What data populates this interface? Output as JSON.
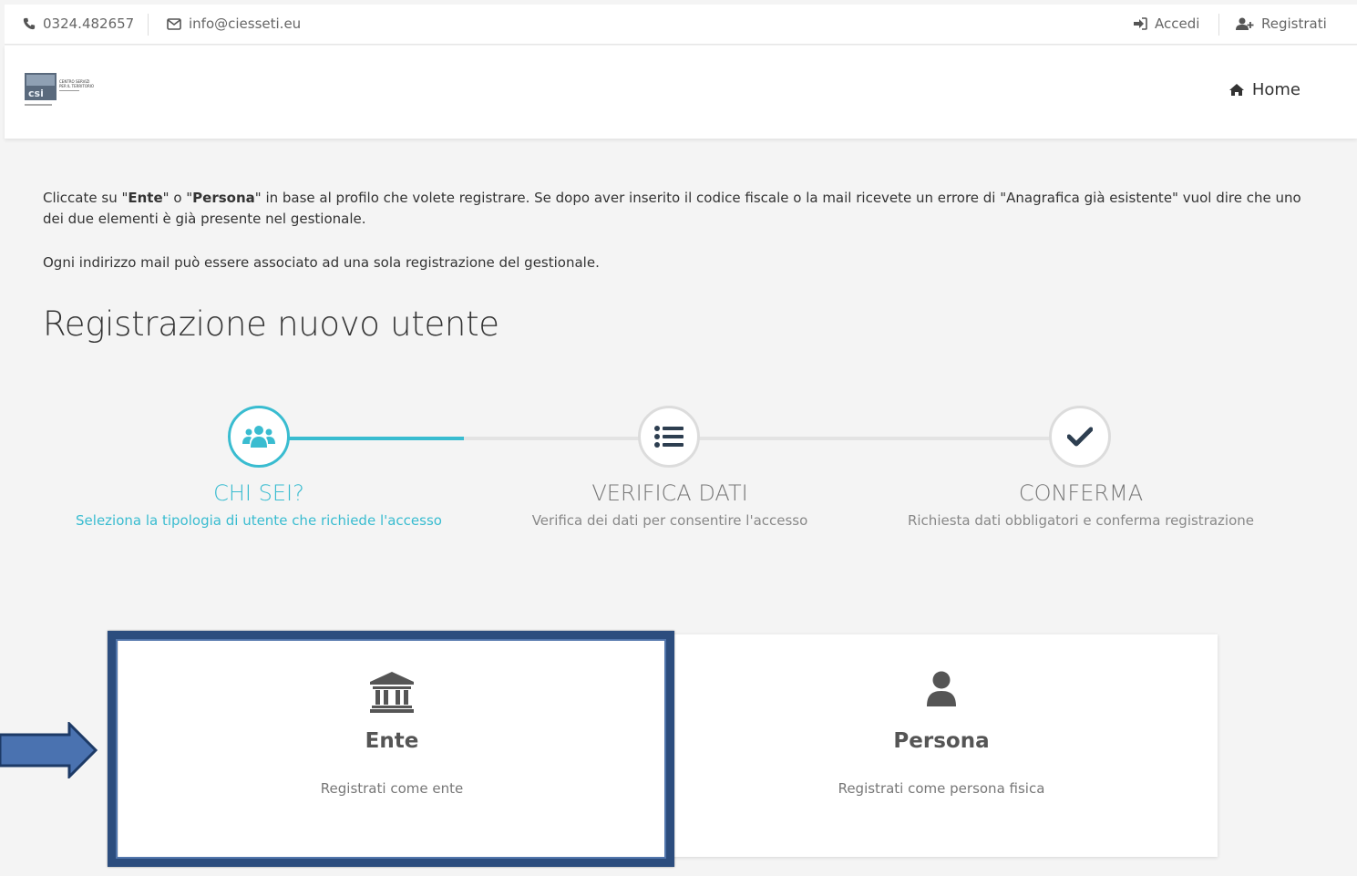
{
  "topbar": {
    "phone": "0324.482657",
    "email": "info@ciesseti.eu",
    "login_label": "Accedi",
    "register_label": "Registrati"
  },
  "header": {
    "logo_lines": [
      "CENTRO SERVIZI",
      "PER IL TERRITORIO"
    ],
    "home_label": "Home"
  },
  "intro": {
    "p1_a": "Cliccate su \"",
    "p1_ente": "Ente",
    "p1_b": "\" o \"",
    "p1_persona": "Persona",
    "p1_c": "\" in base al profilo che volete registrare. Se dopo aver inserito il codice fiscale o la mail ricevete un errore di \"Anagrafica già esistente\" vuol dire che uno dei due elementi è già presente nel gestionale.",
    "p2": "Ogni indirizzo mail può essere associato ad una sola registrazione del gestionale."
  },
  "page_title": "Registrazione nuovo utente",
  "steps": [
    {
      "title": "CHI SEI?",
      "desc": "Seleziona la tipologia di utente che richiede l'accesso",
      "icon": "users-icon",
      "active": true
    },
    {
      "title": "VERIFICA DATI",
      "desc": "Verifica dei dati per consentire l'accesso",
      "icon": "list-icon",
      "active": false
    },
    {
      "title": "CONFERMA",
      "desc": "Richiesta dati obbligatori e conferma registrazione",
      "icon": "check-icon",
      "active": false
    }
  ],
  "cards": [
    {
      "name": "Ente",
      "sub": "Registrati come ente",
      "icon": "bank-icon"
    },
    {
      "name": "Persona",
      "sub": "Registrati come persona fisica",
      "icon": "user-icon"
    }
  ],
  "colors": {
    "accent": "#39bcd0",
    "highlight": "#2c4d7e",
    "arrow": "#4a72b0"
  }
}
